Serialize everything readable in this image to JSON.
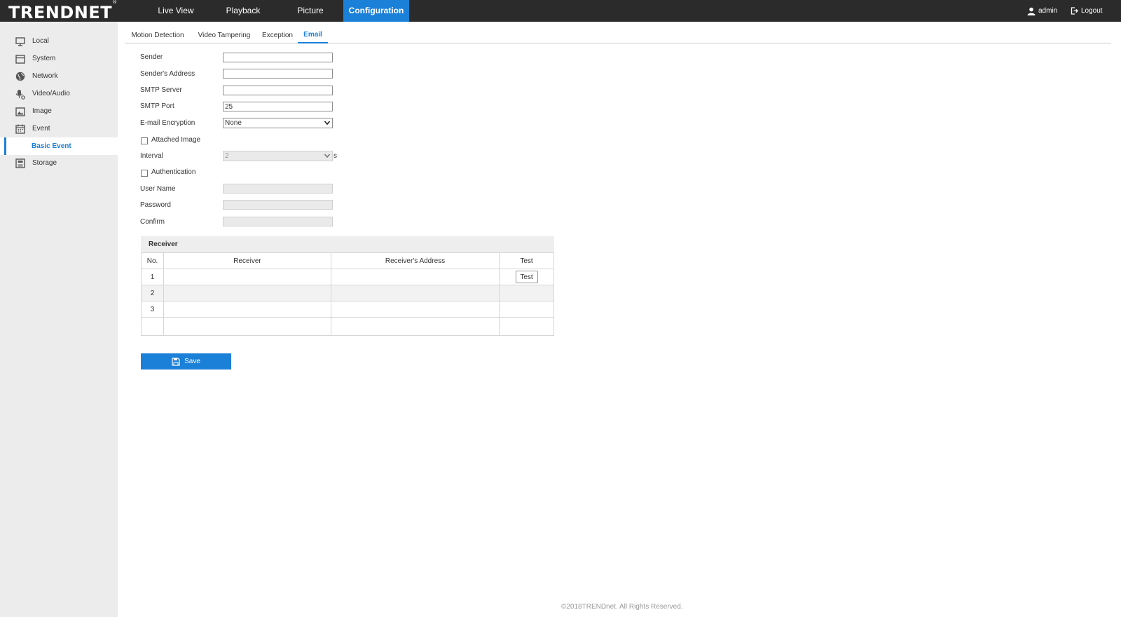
{
  "brand": {
    "logo_text": "TRENDNET",
    "trademark": "®"
  },
  "nav": {
    "items": [
      {
        "label": "Live View"
      },
      {
        "label": "Playback"
      },
      {
        "label": "Picture"
      },
      {
        "label": "Configuration"
      }
    ],
    "active_index": 3,
    "user": "admin",
    "logout": "Logout"
  },
  "sidebar": {
    "items": [
      {
        "label": "Local",
        "icon": "monitor-icon"
      },
      {
        "label": "System",
        "icon": "system-icon"
      },
      {
        "label": "Network",
        "icon": "globe-icon"
      },
      {
        "label": "Video/Audio",
        "icon": "microphone-icon"
      },
      {
        "label": "Image",
        "icon": "image-icon"
      },
      {
        "label": "Event",
        "icon": "calendar-icon"
      },
      {
        "label": "Basic Event",
        "icon": "",
        "active": true
      },
      {
        "label": "Storage",
        "icon": "storage-icon"
      }
    ]
  },
  "tabs": {
    "items": [
      {
        "label": "Motion Detection"
      },
      {
        "label": "Video Tampering"
      },
      {
        "label": "Exception"
      },
      {
        "label": "Email"
      }
    ],
    "active_index": 3
  },
  "form": {
    "sender_label": "Sender",
    "sender_value": "",
    "sender_address_label": "Sender's Address",
    "sender_address_value": "",
    "smtp_server_label": "SMTP Server",
    "smtp_server_value": "",
    "smtp_port_label": "SMTP Port",
    "smtp_port_value": "25",
    "encryption_label": "E-mail Encryption",
    "encryption_value": "None",
    "attached_image_label": "Attached Image",
    "attached_image_checked": false,
    "interval_label": "Interval",
    "interval_value": "2",
    "interval_unit": "s",
    "authentication_label": "Authentication",
    "authentication_checked": false,
    "username_label": "User Name",
    "password_label": "Password",
    "confirm_label": "Confirm"
  },
  "receiver": {
    "title": "Receiver",
    "columns": [
      "No.",
      "Receiver",
      "Receiver's Address",
      "Test"
    ],
    "rows": [
      {
        "no": "1",
        "receiver": "",
        "address": "",
        "test": "Test"
      },
      {
        "no": "2",
        "receiver": "",
        "address": "",
        "test": ""
      },
      {
        "no": "3",
        "receiver": "",
        "address": "",
        "test": ""
      }
    ]
  },
  "save_label": "Save",
  "footer": "©2018TRENDnet. All Rights Reserved.",
  "colors": {
    "accent": "#1b80d8",
    "topbar": "#2b2b2b",
    "sidebar": "#ececec"
  }
}
